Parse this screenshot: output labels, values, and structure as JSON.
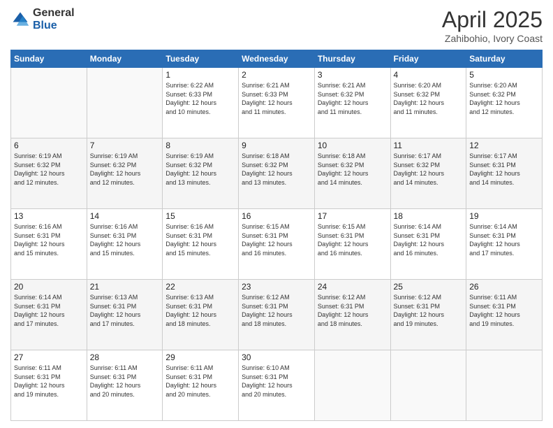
{
  "logo": {
    "general": "General",
    "blue": "Blue"
  },
  "title": "April 2025",
  "subtitle": "Zahibohio, Ivory Coast",
  "weekdays": [
    "Sunday",
    "Monday",
    "Tuesday",
    "Wednesday",
    "Thursday",
    "Friday",
    "Saturday"
  ],
  "weeks": [
    [
      {
        "day": "",
        "info": ""
      },
      {
        "day": "",
        "info": ""
      },
      {
        "day": "1",
        "info": "Sunrise: 6:22 AM\nSunset: 6:33 PM\nDaylight: 12 hours\nand 10 minutes."
      },
      {
        "day": "2",
        "info": "Sunrise: 6:21 AM\nSunset: 6:33 PM\nDaylight: 12 hours\nand 11 minutes."
      },
      {
        "day": "3",
        "info": "Sunrise: 6:21 AM\nSunset: 6:32 PM\nDaylight: 12 hours\nand 11 minutes."
      },
      {
        "day": "4",
        "info": "Sunrise: 6:20 AM\nSunset: 6:32 PM\nDaylight: 12 hours\nand 11 minutes."
      },
      {
        "day": "5",
        "info": "Sunrise: 6:20 AM\nSunset: 6:32 PM\nDaylight: 12 hours\nand 12 minutes."
      }
    ],
    [
      {
        "day": "6",
        "info": "Sunrise: 6:19 AM\nSunset: 6:32 PM\nDaylight: 12 hours\nand 12 minutes."
      },
      {
        "day": "7",
        "info": "Sunrise: 6:19 AM\nSunset: 6:32 PM\nDaylight: 12 hours\nand 12 minutes."
      },
      {
        "day": "8",
        "info": "Sunrise: 6:19 AM\nSunset: 6:32 PM\nDaylight: 12 hours\nand 13 minutes."
      },
      {
        "day": "9",
        "info": "Sunrise: 6:18 AM\nSunset: 6:32 PM\nDaylight: 12 hours\nand 13 minutes."
      },
      {
        "day": "10",
        "info": "Sunrise: 6:18 AM\nSunset: 6:32 PM\nDaylight: 12 hours\nand 14 minutes."
      },
      {
        "day": "11",
        "info": "Sunrise: 6:17 AM\nSunset: 6:32 PM\nDaylight: 12 hours\nand 14 minutes."
      },
      {
        "day": "12",
        "info": "Sunrise: 6:17 AM\nSunset: 6:31 PM\nDaylight: 12 hours\nand 14 minutes."
      }
    ],
    [
      {
        "day": "13",
        "info": "Sunrise: 6:16 AM\nSunset: 6:31 PM\nDaylight: 12 hours\nand 15 minutes."
      },
      {
        "day": "14",
        "info": "Sunrise: 6:16 AM\nSunset: 6:31 PM\nDaylight: 12 hours\nand 15 minutes."
      },
      {
        "day": "15",
        "info": "Sunrise: 6:16 AM\nSunset: 6:31 PM\nDaylight: 12 hours\nand 15 minutes."
      },
      {
        "day": "16",
        "info": "Sunrise: 6:15 AM\nSunset: 6:31 PM\nDaylight: 12 hours\nand 16 minutes."
      },
      {
        "day": "17",
        "info": "Sunrise: 6:15 AM\nSunset: 6:31 PM\nDaylight: 12 hours\nand 16 minutes."
      },
      {
        "day": "18",
        "info": "Sunrise: 6:14 AM\nSunset: 6:31 PM\nDaylight: 12 hours\nand 16 minutes."
      },
      {
        "day": "19",
        "info": "Sunrise: 6:14 AM\nSunset: 6:31 PM\nDaylight: 12 hours\nand 17 minutes."
      }
    ],
    [
      {
        "day": "20",
        "info": "Sunrise: 6:14 AM\nSunset: 6:31 PM\nDaylight: 12 hours\nand 17 minutes."
      },
      {
        "day": "21",
        "info": "Sunrise: 6:13 AM\nSunset: 6:31 PM\nDaylight: 12 hours\nand 17 minutes."
      },
      {
        "day": "22",
        "info": "Sunrise: 6:13 AM\nSunset: 6:31 PM\nDaylight: 12 hours\nand 18 minutes."
      },
      {
        "day": "23",
        "info": "Sunrise: 6:12 AM\nSunset: 6:31 PM\nDaylight: 12 hours\nand 18 minutes."
      },
      {
        "day": "24",
        "info": "Sunrise: 6:12 AM\nSunset: 6:31 PM\nDaylight: 12 hours\nand 18 minutes."
      },
      {
        "day": "25",
        "info": "Sunrise: 6:12 AM\nSunset: 6:31 PM\nDaylight: 12 hours\nand 19 minutes."
      },
      {
        "day": "26",
        "info": "Sunrise: 6:11 AM\nSunset: 6:31 PM\nDaylight: 12 hours\nand 19 minutes."
      }
    ],
    [
      {
        "day": "27",
        "info": "Sunrise: 6:11 AM\nSunset: 6:31 PM\nDaylight: 12 hours\nand 19 minutes."
      },
      {
        "day": "28",
        "info": "Sunrise: 6:11 AM\nSunset: 6:31 PM\nDaylight: 12 hours\nand 20 minutes."
      },
      {
        "day": "29",
        "info": "Sunrise: 6:11 AM\nSunset: 6:31 PM\nDaylight: 12 hours\nand 20 minutes."
      },
      {
        "day": "30",
        "info": "Sunrise: 6:10 AM\nSunset: 6:31 PM\nDaylight: 12 hours\nand 20 minutes."
      },
      {
        "day": "",
        "info": ""
      },
      {
        "day": "",
        "info": ""
      },
      {
        "day": "",
        "info": ""
      }
    ]
  ]
}
